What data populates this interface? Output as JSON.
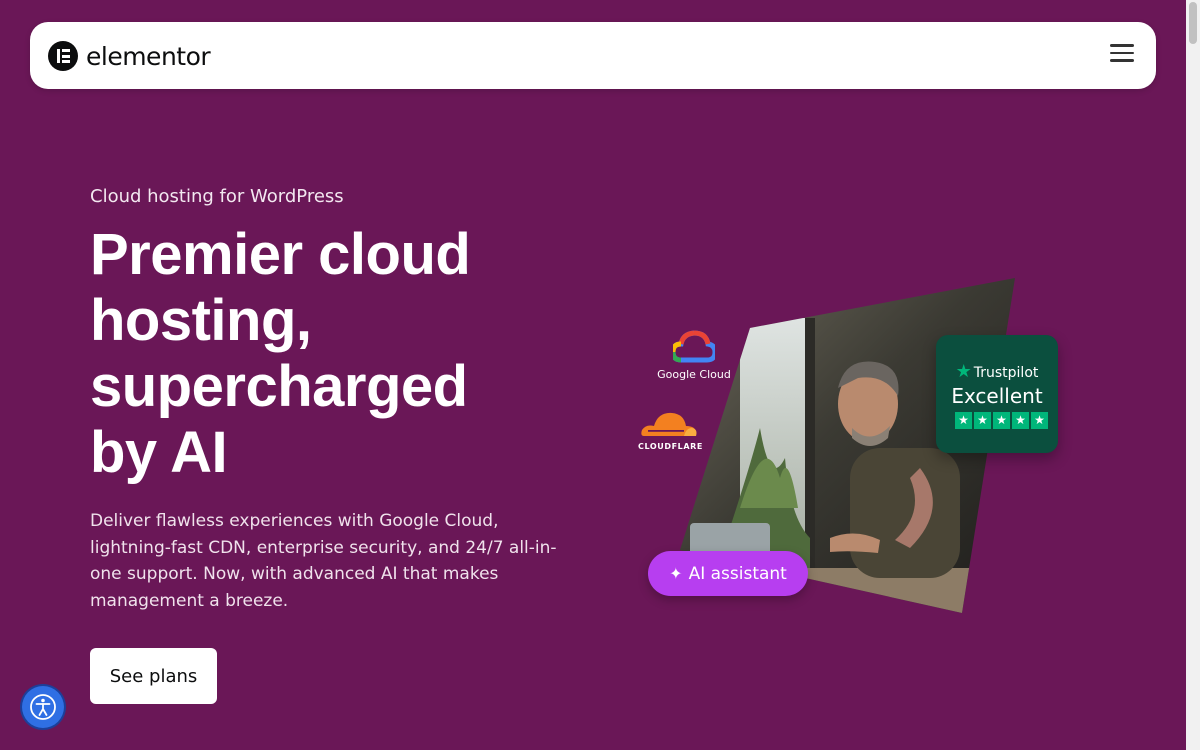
{
  "header": {
    "brand": "elementor",
    "menu_icon": "hamburger-menu-icon"
  },
  "hero": {
    "eyebrow": "Cloud hosting for WordPress",
    "headline": "Premier cloud hosting, supercharged by AI",
    "description": "Deliver flawless experiences with Google Cloud, lightning-fast CDN, enterprise security, and 24/7 all-in-one support. Now, with advanced AI that makes management a breeze.",
    "cta_label": "See plans"
  },
  "partners": {
    "google_cloud": "Google Cloud",
    "cloudflare": "CLOUDFLARE"
  },
  "trustpilot": {
    "brand": "Trustpilot",
    "rating": "Excellent",
    "stars": 5
  },
  "ai_badge": {
    "label": "AI assistant",
    "icon": "sparkle-icon"
  },
  "accessibility": {
    "icon": "accessibility-icon"
  },
  "colors": {
    "background": "#6a1757",
    "accent_pill": "#b73ef0",
    "trustpilot_bg": "#0b4f3e",
    "trustpilot_green": "#00b67a",
    "a11y_button": "#2f6fe4"
  }
}
